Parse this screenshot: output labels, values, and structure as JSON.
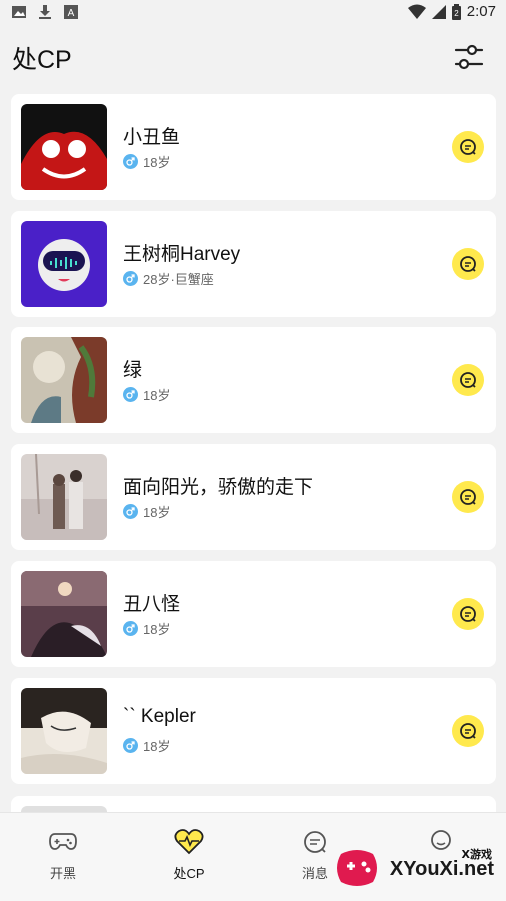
{
  "status_bar": {
    "time": "2:07",
    "icons": [
      "image-icon",
      "download-icon",
      "a-icon",
      "wifi-icon",
      "signal-icon",
      "battery-icon"
    ]
  },
  "header": {
    "title": "处CP",
    "filter_icon": "sliders-icon"
  },
  "users": [
    {
      "name": "小丑鱼",
      "meta": "18岁"
    },
    {
      "name": "王树桐Harvey",
      "meta": "28岁·巨蟹座"
    },
    {
      "name": "绿",
      "meta": "18岁"
    },
    {
      "name": "面向阳光，骄傲的走下",
      "meta": "18岁"
    },
    {
      "name": "丑八怪",
      "meta": "18岁"
    },
    {
      "name": "`` Kepler",
      "meta": "18岁"
    }
  ],
  "tabs": [
    {
      "label": "开黑",
      "icon": "gamepad-icon"
    },
    {
      "label": "处CP",
      "icon": "heart-pulse-icon"
    },
    {
      "label": "消息",
      "icon": "message-icon"
    },
    {
      "label": "",
      "icon": "profile-icon"
    }
  ],
  "watermark": {
    "top": "X游戏",
    "main": "XYouXi.net"
  },
  "colors": {
    "accent": "#ffe94d",
    "gender": "#5ab4ef",
    "background": "#f2f2f2"
  }
}
